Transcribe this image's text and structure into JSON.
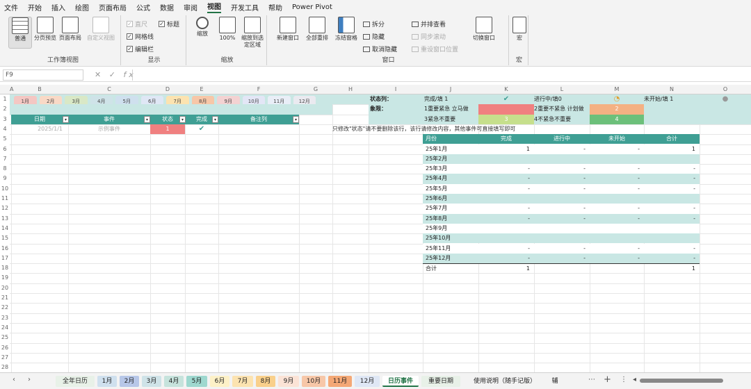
{
  "menu": {
    "items": [
      "文件",
      "开始",
      "插入",
      "绘图",
      "页面布局",
      "公式",
      "数据",
      "审阅",
      "视图",
      "开发工具",
      "帮助",
      "Power Pivot"
    ],
    "active_index": 8
  },
  "ribbon": {
    "workbook_views": {
      "label": "工作簿视图",
      "normal": "普通",
      "page_break": "分页预览",
      "page_layout": "页面布局",
      "custom_views": "自定义视图"
    },
    "show": {
      "label": "显示",
      "ruler": "直尺",
      "gridlines": "网格线",
      "formula_bar": "编辑栏",
      "headings": "标题"
    },
    "zoom": {
      "label": "缩放",
      "zoom": "缩放",
      "hundred": "100%",
      "zoom_to_selection": "缩放到选定区域"
    },
    "window": {
      "label": "窗口",
      "new_window": "新建窗口",
      "arrange_all": "全部重排",
      "freeze_panes": "冻结窗格",
      "split": "拆分",
      "hide": "隐藏",
      "unhide": "取消隐藏",
      "side_by_side": "并排查看",
      "sync_scroll": "同步滚动",
      "reset_position": "重设窗口位置",
      "switch_windows": "切换窗口"
    },
    "macros": {
      "label": "宏",
      "macros": "宏"
    }
  },
  "formula_bar": {
    "name_box": "F9",
    "fx": "fx",
    "cancel": "✕",
    "enter": "✓",
    "content": ""
  },
  "columns": [
    "A",
    "B",
    "C",
    "D",
    "E",
    "F",
    "G",
    "H",
    "I",
    "J",
    "K",
    "L",
    "M",
    "N",
    "O"
  ],
  "rows": [
    "1",
    "2",
    "3",
    "4",
    "5",
    "6",
    "7",
    "8",
    "9",
    "10",
    "11",
    "12",
    "13",
    "14",
    "15",
    "16",
    "17",
    "18",
    "19",
    "20",
    "21",
    "22",
    "23",
    "24",
    "25",
    "26",
    "27",
    "28"
  ],
  "month_tabs": [
    "1月",
    "2月",
    "3月",
    "4月",
    "5月",
    "6月",
    "7月",
    "8月",
    "9月",
    "10月",
    "11月",
    "12月"
  ],
  "month_tab_colors": [
    "#f4c7c3",
    "#f9d9c6",
    "#d9e8c6",
    "#cfe3e8",
    "#cfe0ee",
    "#dfe7f5",
    "#fce3b0",
    "#f7c7a8",
    "#f3d2d2",
    "#e3e6f6",
    "#e9eef7",
    "#eaeaf0"
  ],
  "table_headers": {
    "date": "日期",
    "event": "事件",
    "status": "状态",
    "done": "完成",
    "notes": "备注列"
  },
  "sample_row": {
    "date": "2025/1/1",
    "event": "示例事件",
    "status": "1",
    "check": "✔"
  },
  "legend": {
    "status_label": "状态列：",
    "done": "完成/填 1",
    "in_progress": "进行中/填0",
    "not_started": "未开始/填 1",
    "priority_label": "象限：",
    "q1": "1重要紧急 立马做",
    "q2": "2重要不紧急 计划做",
    "q2_val": "2",
    "q3": "3紧急不重要",
    "q3_val": "3",
    "q4": "4不紧急不重要",
    "q4_val": "4"
  },
  "note": "只修改\"状态\"请不要删除该行，该行请修改内容，其他事件可直接填写即可",
  "summary": {
    "headers": [
      "月份",
      "完成",
      "进行中",
      "未开始",
      "合计"
    ],
    "rows": [
      [
        "25年1月",
        "1",
        "-",
        "-",
        "1"
      ],
      [
        "25年2月",
        "",
        "",
        "",
        ""
      ],
      [
        "25年3月",
        "-",
        "-",
        "-",
        "-"
      ],
      [
        "25年4月",
        "-",
        "-",
        "-",
        "-"
      ],
      [
        "25年5月",
        "-",
        "-",
        "-",
        "-"
      ],
      [
        "25年6月",
        "",
        "",
        "",
        ""
      ],
      [
        "25年7月",
        "-",
        "-",
        "-",
        "-"
      ],
      [
        "25年8月",
        "-",
        "-",
        "-",
        "-"
      ],
      [
        "25年9月",
        "",
        "",
        "",
        ""
      ],
      [
        "25年10月",
        "",
        "",
        "",
        ""
      ],
      [
        "25年11月",
        "-",
        "-",
        "-",
        "-"
      ],
      [
        "25年12月",
        "-",
        "-",
        "-",
        "-"
      ]
    ],
    "total_label": "合计",
    "total_done": "1",
    "total_sum": "1"
  },
  "sheet_tabs": [
    {
      "label": "全年日历",
      "color": "#e8f1e8"
    },
    {
      "label": "1月",
      "color": "#cfe0ee"
    },
    {
      "label": "2月",
      "color": "#b7c7e8"
    },
    {
      "label": "3月",
      "color": "#cfe3e8"
    },
    {
      "label": "4月",
      "color": "#c6e3dc"
    },
    {
      "label": "5月",
      "color": "#9ed8cf"
    },
    {
      "label": "6月",
      "color": "#fdf1c7"
    },
    {
      "label": "7月",
      "color": "#fce3b0"
    },
    {
      "label": "8月",
      "color": "#f9d08b"
    },
    {
      "label": "9月",
      "color": "#fbe3d6"
    },
    {
      "label": "10月",
      "color": "#f7c7a8"
    },
    {
      "label": "11月",
      "color": "#f4a876"
    },
    {
      "label": "12月",
      "color": "#dfe7f5"
    },
    {
      "label": "日历事件",
      "color": "#ffffff"
    },
    {
      "label": "重要日期",
      "color": "#e8f1e8"
    },
    {
      "label": "使用说明（随手记版）",
      "color": "#f3f3f3"
    },
    {
      "label": "辅",
      "color": "#f3f3f3"
    }
  ],
  "active_sheet": 13,
  "colors": {
    "teal": "#3f9f94",
    "teal_light": "#c9e7e4",
    "red": "#f08080",
    "orange": "#f4b183",
    "yellow_green": "#c6df8c",
    "green": "#6cc07a",
    "accent": "#217346"
  }
}
